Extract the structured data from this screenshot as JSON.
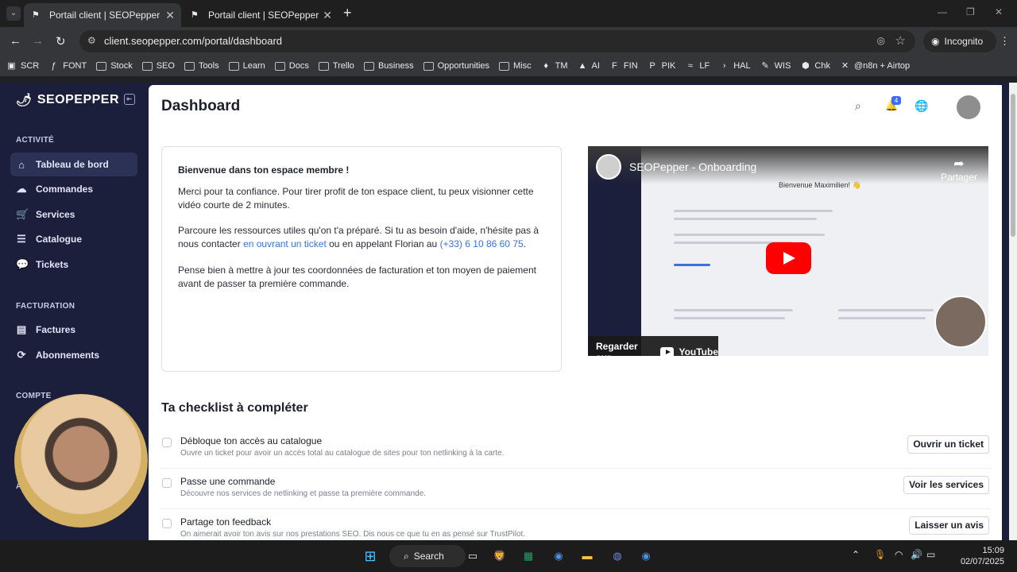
{
  "browser": {
    "tabs": [
      {
        "title": "Portail client | SEOPepper",
        "active": true
      },
      {
        "title": "Portail client | SEOPepper",
        "active": false
      }
    ],
    "url": "client.seopepper.com/portal/dashboard",
    "incognito_label": "Incognito",
    "bookmarks": [
      "SCR",
      "FONT",
      "Stock",
      "SEO",
      "Tools",
      "Learn",
      "Docs",
      "Trello",
      "Business",
      "Opportunities",
      "Misc",
      "TM",
      "AI",
      "FIN",
      "PIK",
      "LF",
      "HAL",
      "WIS",
      "Chk",
      "@n8n + Airtop"
    ]
  },
  "sidebar": {
    "brand": "SEOPEPPER",
    "sections": {
      "activite": "ACTIVITÉ",
      "facturation": "FACTURATION",
      "compte": "COMPTE",
      "affiliation_initial": "A"
    },
    "items": {
      "tableau": "Tableau de bord",
      "commandes": "Commandes",
      "services": "Services",
      "catalogue": "Catalogue",
      "tickets": "Tickets",
      "factures": "Factures",
      "abonnements": "Abonnements"
    }
  },
  "header": {
    "title": "Dashboard",
    "notification_count": "4"
  },
  "welcome": {
    "heading": "Bienvenue dans ton espace membre !",
    "p1": "Merci pour ta confiance. Pour tirer profit de ton espace client, tu peux visionner cette vidéo courte de 2 minutes.",
    "p2_before": "Parcoure les ressources utiles qu'on t'a préparé. Si tu as besoin d'aide, n'hésite pas à nous contacter ",
    "p2_link1": "en ouvrant un ticket",
    "p2_middle": " ou en appelant Florian au ",
    "p2_link2": "(+33) 6 10 86 60 75",
    "p2_after": ".",
    "p3": "Pense bien à mettre à jour tes coordonnées de facturation et ton moyen de paiement avant de passer ta première commande."
  },
  "video": {
    "title": "SEOPepper - Onboarding",
    "share_label": "Partager",
    "watch_on": "Regarder sur",
    "youtube": "YouTube",
    "inner_heading": "Bienvenue Maximilien! 👋"
  },
  "checklist": {
    "title": "Ta checklist à compléter",
    "items": [
      {
        "title": "Débloque ton accès au catalogue",
        "subtitle": "Ouvre un ticket pour avoir un accès total au catalogue de sites pour ton netlinking à la carte.",
        "button": "Ouvrir un ticket"
      },
      {
        "title": "Passe une commande",
        "subtitle": "Découvre nos services de netlinking et passe ta première commande.",
        "button": "Voir les services"
      },
      {
        "title": "Partage ton feedback",
        "subtitle": "On aimerait avoir ton avis sur nos prestations SEO. Dis nous ce que tu en as pensé sur TrustPilot.",
        "button": "Laisser un avis"
      }
    ]
  },
  "taskbar": {
    "search": "Search",
    "time": "15:09",
    "date": "02/07/2025"
  },
  "colors": {
    "sidebar_bg": "#1b1f3b",
    "link": "#3a70e0",
    "youtube_red": "#ff0000",
    "badge": "#3b6cf6"
  }
}
